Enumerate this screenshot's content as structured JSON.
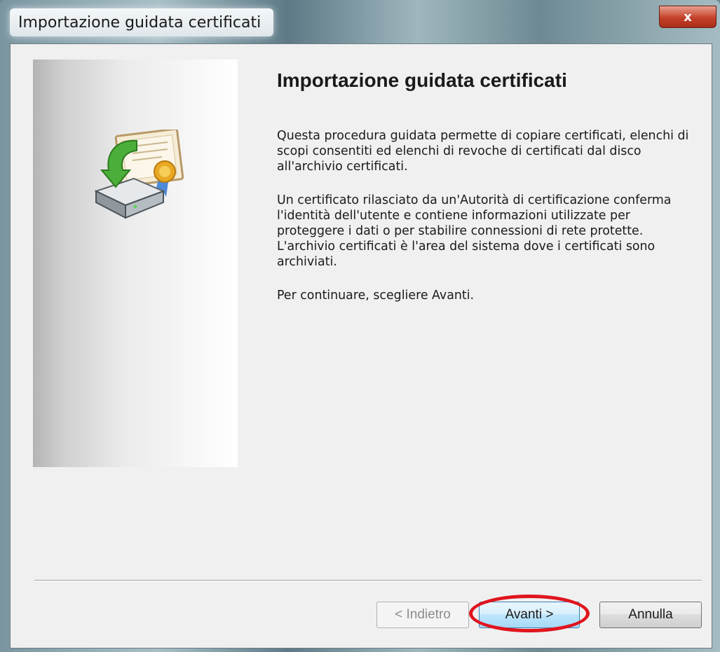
{
  "window": {
    "title": "Importazione guidata certificati",
    "close_glyph": "x"
  },
  "wizard": {
    "heading": "Importazione guidata certificati",
    "paragraphs": [
      "Questa procedura guidata permette di copiare certificati, elenchi di scopi consentiti ed elenchi di revoche di certificati dal disco all'archivio certificati.",
      "Un certificato rilasciato da un'Autorità di certificazione conferma l'identità dell'utente e contiene informazioni utilizzate per proteggere i dati o per stabilire connessioni di rete protette. L'archivio certificati è l'area del sistema dove i certificati sono archiviati.",
      "Per continuare, scegliere Avanti."
    ],
    "icon": "certificate-import-icon"
  },
  "buttons": {
    "back": "< Indietro",
    "next": "Avanti >",
    "cancel": "Annulla",
    "back_enabled": false
  },
  "annotation": {
    "color": "#e0141e",
    "target": "next-button"
  }
}
